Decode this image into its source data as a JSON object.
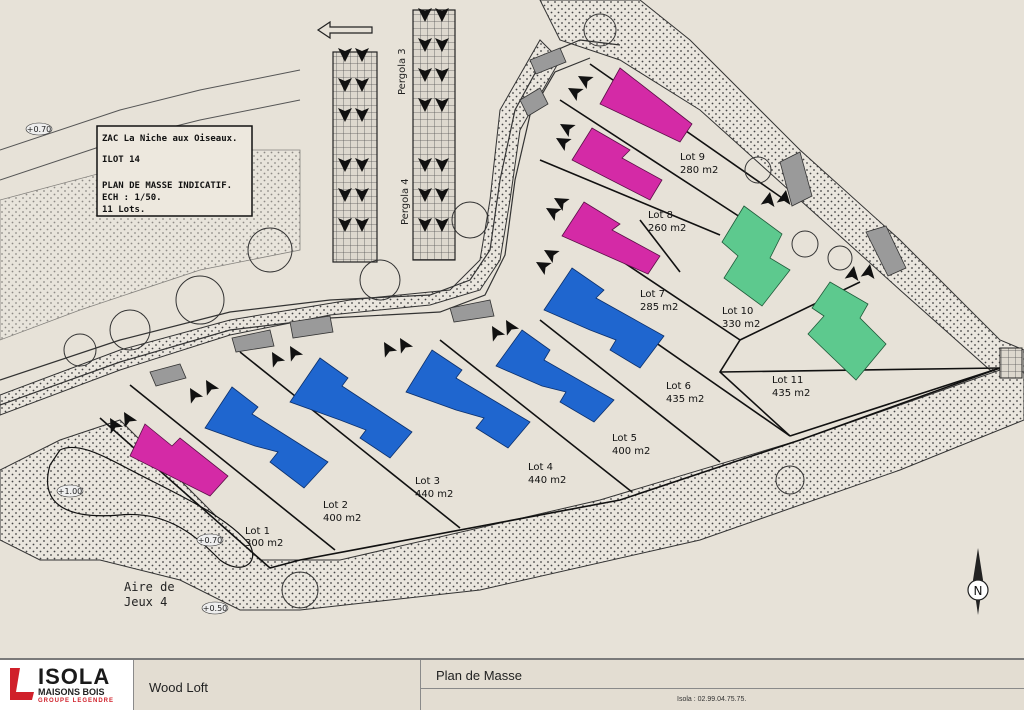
{
  "legend_box": {
    "line1": "ZAC La Niche aux Oiseaux.",
    "line2": "ILOT 14",
    "line3": "PLAN DE MASSE INDICATIF.",
    "line4": "ECH : 1/50.",
    "line5": "11 Lots."
  },
  "lots": [
    {
      "name": "Lot 1",
      "area": "300 m2"
    },
    {
      "name": "Lot 2",
      "area": "400 m2"
    },
    {
      "name": "Lot 3",
      "area": "440 m2"
    },
    {
      "name": "Lot 4",
      "area": "440 m2"
    },
    {
      "name": "Lot 5",
      "area": "400 m2"
    },
    {
      "name": "Lot 6",
      "area": "435 m2"
    },
    {
      "name": "Lot 7",
      "area": "285 m2"
    },
    {
      "name": "Lot 8",
      "area": "260 m2"
    },
    {
      "name": "Lot 9",
      "area": "280 m2"
    },
    {
      "name": "Lot 10",
      "area": "330 m2"
    },
    {
      "name": "Lot 11",
      "area": "435 m2"
    }
  ],
  "labels": {
    "pergola3": "Pergola 3",
    "pergola4": "Pergola 4",
    "aire_line1": "Aire de",
    "aire_line2": "Jeux 4",
    "level_070": "+0.70",
    "level_100": "+1.00",
    "level_070b": "+0.70",
    "level_050": "+0.50",
    "north": "N"
  },
  "colors": {
    "magenta": "#d42aa6",
    "blue": "#1f66cf",
    "green": "#5dc98e",
    "grey_parking": "#9a9a9a"
  },
  "footer": {
    "brand": "ISOLA",
    "brand_sub": "MAISONS BOIS",
    "brand_tag": "GROUPE LEGENDRE",
    "model": "Wood Loft",
    "doc_title": "Plan de Masse",
    "contact": "Isola : 02.99.04.75.75."
  }
}
